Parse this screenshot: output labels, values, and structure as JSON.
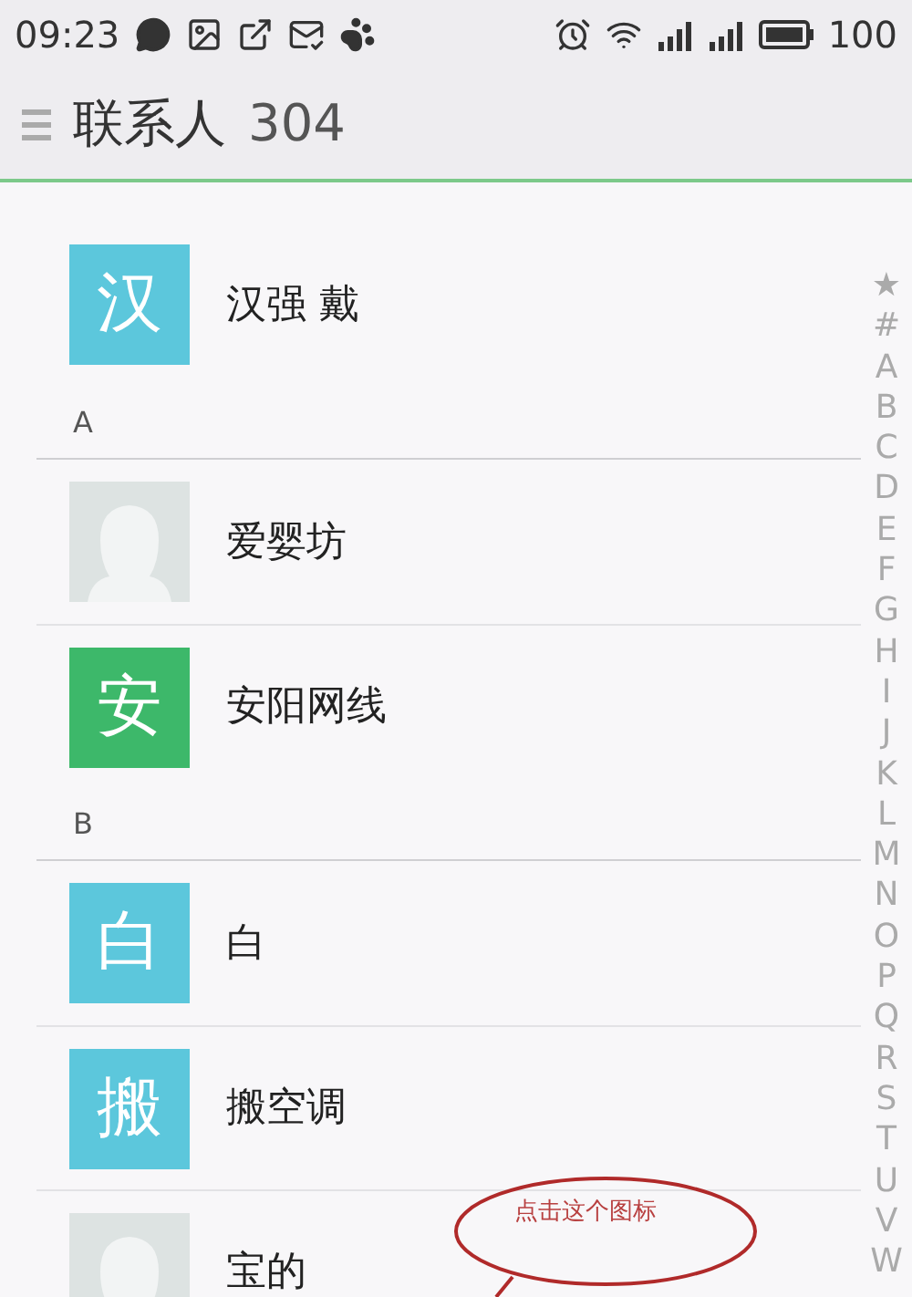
{
  "status_bar": {
    "time": "09:23",
    "battery": "100"
  },
  "header": {
    "title": "联系人",
    "count": "304"
  },
  "list": [
    {
      "kind": "contact",
      "name": "汉强 戴",
      "avatar": {
        "kind": "letter",
        "text": "汉",
        "color": "#5cc7dc"
      }
    },
    {
      "kind": "section",
      "label": "A"
    },
    {
      "kind": "contact",
      "name": "爱婴坊",
      "avatar": {
        "kind": "photo"
      }
    },
    {
      "kind": "contact",
      "name": "安阳网线",
      "avatar": {
        "kind": "letter",
        "text": "安",
        "color": "#3db86a"
      }
    },
    {
      "kind": "section",
      "label": "B"
    },
    {
      "kind": "contact",
      "name": "白",
      "avatar": {
        "kind": "letter",
        "text": "白",
        "color": "#5cc7dc"
      }
    },
    {
      "kind": "contact",
      "name": "搬空调",
      "avatar": {
        "kind": "letter",
        "text": "搬",
        "color": "#5cc7dc"
      }
    },
    {
      "kind": "contact",
      "name": "宝的",
      "avatar": {
        "kind": "photo"
      }
    }
  ],
  "index": [
    "★",
    "#",
    "A",
    "B",
    "C",
    "D",
    "E",
    "F",
    "G",
    "H",
    "I",
    "J",
    "K",
    "L",
    "M",
    "N",
    "O",
    "P",
    "Q",
    "R",
    "S",
    "T",
    "U",
    "V",
    "W"
  ],
  "annotation": {
    "text": "点击这个图标"
  }
}
